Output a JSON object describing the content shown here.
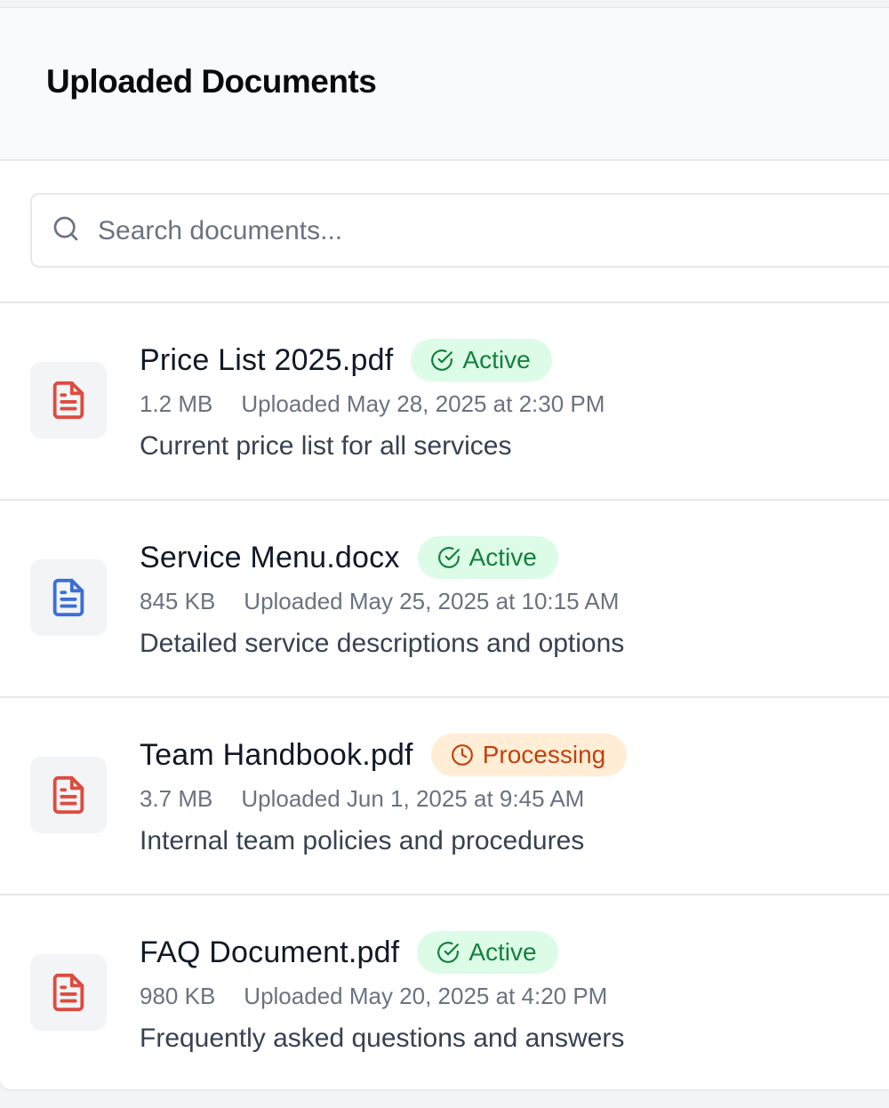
{
  "header": {
    "title": "Uploaded Documents"
  },
  "search": {
    "placeholder": "Search documents...",
    "value": "",
    "icon": "search-icon"
  },
  "colors": {
    "pdf": "#dc4c3f",
    "docx": "#3b6fd8",
    "active_bg": "#dcfce7",
    "active_text": "#15803d",
    "processing_bg": "#ffedd5",
    "processing_text": "#c2410c"
  },
  "documents": [
    {
      "name": "Price List 2025.pdf",
      "status": "Active",
      "size": "1.2 MB",
      "uploaded": "Uploaded May 28, 2025 at 2:30 PM",
      "description": "Current price list for all services",
      "icon": "pdf-file-icon"
    },
    {
      "name": "Service Menu.docx",
      "status": "Active",
      "size": "845 KB",
      "uploaded": "Uploaded May 25, 2025 at 10:15 AM",
      "description": "Detailed service descriptions and options",
      "icon": "docx-file-icon"
    },
    {
      "name": "Team Handbook.pdf",
      "status": "Processing",
      "size": "3.7 MB",
      "uploaded": "Uploaded Jun 1, 2025 at 9:45 AM",
      "description": "Internal team policies and procedures",
      "icon": "pdf-file-icon"
    },
    {
      "name": "FAQ Document.pdf",
      "status": "Active",
      "size": "980 KB",
      "uploaded": "Uploaded May 20, 2025 at 4:20 PM",
      "description": "Frequently asked questions and answers",
      "icon": "pdf-file-icon"
    }
  ]
}
